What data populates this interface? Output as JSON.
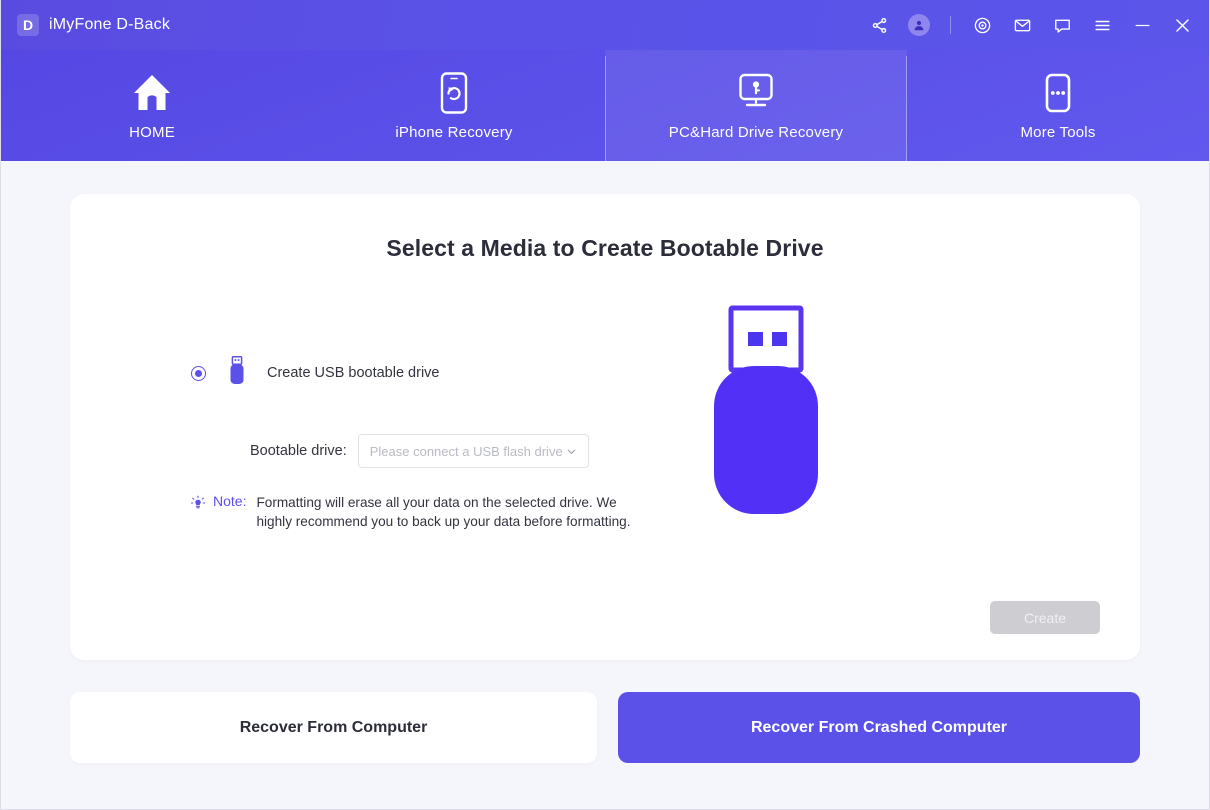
{
  "window": {
    "brand_initial": "D",
    "app_title": "iMyFone D-Back",
    "titlebar_icons": [
      {
        "name": "share-icon",
        "label": "Share"
      },
      {
        "name": "account-avatar-icon",
        "label": "Account"
      },
      {
        "name": "separator",
        "label": ""
      },
      {
        "name": "target-icon",
        "label": "Record"
      },
      {
        "name": "mail-icon",
        "label": "Mail"
      },
      {
        "name": "chat-icon",
        "label": "Feedback"
      },
      {
        "name": "menu-icon",
        "label": "Menu"
      },
      {
        "name": "minimize-icon",
        "label": "Minimize"
      },
      {
        "name": "close-icon",
        "label": "Close"
      }
    ],
    "accent_color": "#5b51e8",
    "titlebar_gradient_from": "#5a4be0",
    "titlebar_gradient_to": "#5b55ea"
  },
  "nav": {
    "tabs": [
      {
        "label": "HOME",
        "icon": "home-icon",
        "active": false
      },
      {
        "label": "iPhone Recovery",
        "icon": "phone-recovery-icon",
        "active": false
      },
      {
        "label": "PC&Hard Drive Recovery",
        "icon": "computer-recovery-icon",
        "active": true
      },
      {
        "label": "More Tools",
        "icon": "more-tools-icon",
        "active": false
      }
    ]
  },
  "card": {
    "title": "Select a Media to Create Bootable Drive",
    "option": {
      "label": "Create USB bootable drive",
      "selected": true,
      "icon": "usb-drive-icon"
    },
    "field": {
      "label": "Bootable drive:",
      "value": "",
      "placeholder": "Please connect a USB flash drive",
      "chevron": "chevron-down-icon"
    },
    "note": {
      "icon": "lightbulb-icon",
      "word": "Note:",
      "text": "Formatting will erase all your data on the selected drive. We highly recommend you to back up your data before formatting.",
      "word_color": "#5b51e8"
    },
    "illustration": "usb-flash-drive-illustration",
    "create_button": {
      "label": "Create",
      "disabled": true
    }
  },
  "bottom": {
    "recover_from_computer": "Recover From Computer",
    "recover_from_crashed_computer": "Recover From Crashed Computer"
  }
}
